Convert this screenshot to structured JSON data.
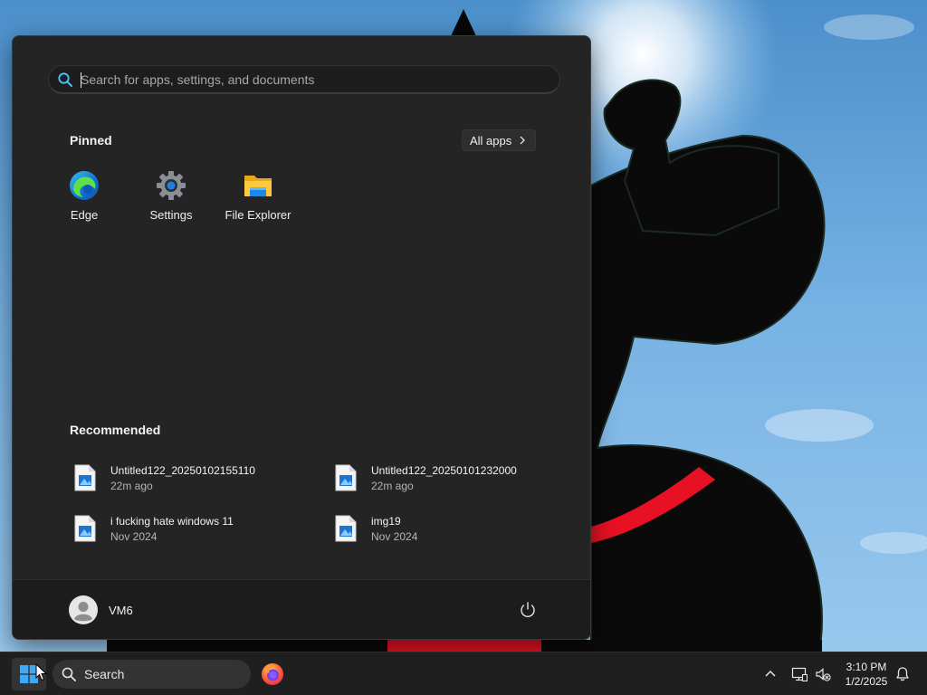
{
  "start_menu": {
    "search": {
      "placeholder": "Search for apps, settings, and documents",
      "value": ""
    },
    "pinned_title": "Pinned",
    "all_apps_label": "All apps",
    "pinned_apps": [
      {
        "label": "Edge",
        "icon": "edge-icon"
      },
      {
        "label": "Settings",
        "icon": "gear-icon"
      },
      {
        "label": "File Explorer",
        "icon": "folder-icon"
      }
    ],
    "recommended_title": "Recommended",
    "recommended": [
      {
        "name": "Untitled122_20250102155110",
        "time": "22m ago",
        "icon": "image-file-icon"
      },
      {
        "name": "Untitled122_20250101232000",
        "time": "22m ago",
        "icon": "image-file-icon"
      },
      {
        "name": "i fucking hate windows 11",
        "time": "Nov 2024",
        "icon": "image-file-icon"
      },
      {
        "name": "img19",
        "time": "Nov 2024",
        "icon": "image-file-icon"
      }
    ],
    "user": {
      "name": "VM6",
      "icon": "user-avatar-icon"
    },
    "power_icon": "power-icon"
  },
  "taskbar": {
    "search_label": "Search",
    "clock": {
      "time": "3:10 PM",
      "date": "1/2/2025"
    },
    "icons": [
      "windows-logo-icon",
      "search-icon",
      "firefox-icon",
      "chevron-up-icon",
      "network-icon",
      "volume-muted-icon",
      "bell-icon"
    ]
  },
  "colors": {
    "menu_bg": "#242424",
    "footer_bg": "#1c1c1c",
    "taskbar_bg": "#1f1f1f",
    "accent": "#0078d4",
    "sky": "#77b2e3",
    "collar_red": "#e81123"
  }
}
